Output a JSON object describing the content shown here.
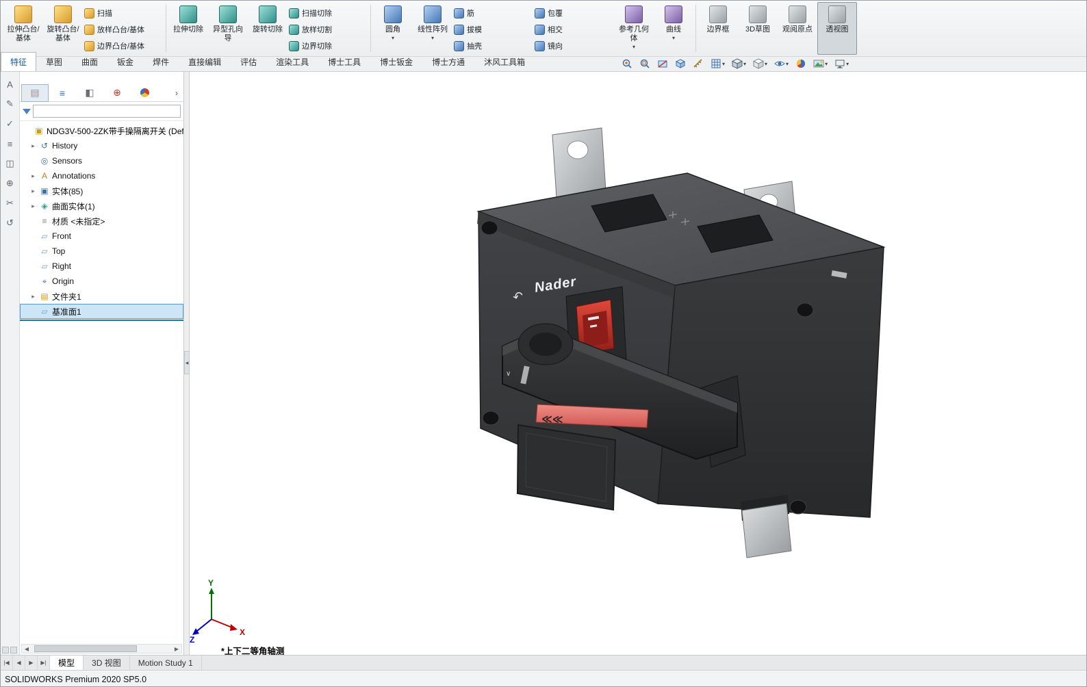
{
  "app": {
    "status_bar": "SOLIDWORKS Premium 2020 SP5.0"
  },
  "ribbon": {
    "items": [
      {
        "type": "big",
        "label": "拉伸凸台/基体",
        "icon": "extrude-boss-icon"
      },
      {
        "type": "big",
        "label": "旋转凸台/基体",
        "icon": "revolve-boss-icon"
      },
      {
        "type": "col",
        "items": [
          {
            "label": "扫描",
            "icon": "sweep-icon"
          },
          {
            "label": "放样凸台/基体",
            "icon": "loft-icon"
          },
          {
            "label": "边界凸台/基体",
            "icon": "boundary-boss-icon"
          }
        ]
      },
      {
        "type": "sep"
      },
      {
        "type": "big",
        "label": "拉伸切除",
        "icon": "extrude-cut-icon"
      },
      {
        "type": "big",
        "label": "异型孔向导",
        "icon": "hole-wizard-icon"
      },
      {
        "type": "big",
        "label": "旋转切除",
        "icon": "revolve-cut-icon"
      },
      {
        "type": "col",
        "items": [
          {
            "label": "扫描切除",
            "icon": "sweep-cut-icon"
          },
          {
            "label": "放样切割",
            "icon": "loft-cut-icon"
          },
          {
            "label": "边界切除",
            "icon": "boundary-cut-icon"
          }
        ]
      },
      {
        "type": "sep"
      },
      {
        "type": "big",
        "label": "圆角",
        "icon": "fillet-icon",
        "caret": true
      },
      {
        "type": "big",
        "label": "线性阵列",
        "icon": "linear-pattern-icon",
        "caret": true
      },
      {
        "type": "col",
        "items": [
          {
            "label": "筋",
            "icon": "rib-icon"
          },
          {
            "label": "拔模",
            "icon": "draft-icon"
          },
          {
            "label": "抽壳",
            "icon": "shell-icon"
          }
        ]
      },
      {
        "type": "col",
        "items": [
          {
            "label": "包覆",
            "icon": "wrap-icon"
          },
          {
            "label": "相交",
            "icon": "intersect-icon"
          },
          {
            "label": "镜向",
            "icon": "mirror-icon"
          }
        ]
      },
      {
        "type": "big",
        "label": "参考几何体",
        "icon": "reference-geometry-icon",
        "caret": true
      },
      {
        "type": "big",
        "label": "曲线",
        "icon": "curves-icon",
        "caret": true
      },
      {
        "type": "sep"
      },
      {
        "type": "big",
        "label": "边界框",
        "icon": "bounding-box-icon"
      },
      {
        "type": "big",
        "label": "3D草图",
        "icon": "3d-sketch-icon"
      },
      {
        "type": "big",
        "label": "观阅原点",
        "icon": "view-origin-icon"
      },
      {
        "type": "big",
        "label": "透视图",
        "icon": "perspective-icon",
        "active": true
      }
    ],
    "tabs": [
      {
        "label": "特征",
        "name": "features",
        "active": true
      },
      {
        "label": "草图",
        "name": "sketch"
      },
      {
        "label": "曲面",
        "name": "surface"
      },
      {
        "label": "钣金",
        "name": "sheet-metal"
      },
      {
        "label": "焊件",
        "name": "weldments"
      },
      {
        "label": "直接编辑",
        "name": "direct-editing"
      },
      {
        "label": "评估",
        "name": "evaluate"
      },
      {
        "label": "渲染工具",
        "name": "render-tools"
      },
      {
        "label": "博士工具",
        "name": "boshi-tools"
      },
      {
        "label": "博士钣金",
        "name": "boshi-sheet-metal"
      },
      {
        "label": "博士方通",
        "name": "boshi-fangtong"
      },
      {
        "label": "沐风工具箱",
        "name": "mufeng-toolbox"
      }
    ],
    "view_toolbar": [
      {
        "icon": "zoom-fit-icon"
      },
      {
        "icon": "zoom-area-icon"
      },
      {
        "icon": "section-view-icon"
      },
      {
        "icon": "view-cube-icon"
      },
      {
        "icon": "measure-icon"
      },
      {
        "icon": "grid-icon",
        "caret": true
      },
      {
        "icon": "view-orientation-icon",
        "caret": true
      },
      {
        "icon": "display-style-icon",
        "caret": true
      },
      {
        "icon": "hide-show-icon",
        "caret": true
      },
      {
        "icon": "edit-appearance-icon"
      },
      {
        "icon": "apply-scene-icon",
        "caret": true
      },
      {
        "icon": "monitor-icon",
        "caret": true
      }
    ]
  },
  "left_toolbar": {
    "icons": [
      "annotation-a-icon",
      "pencil-icon",
      "spellcheck-icon",
      "stack-icon",
      "window-icon",
      "target-icon",
      "scissors-icon",
      "rotate-icon"
    ]
  },
  "feature_panel": {
    "header_tabs": [
      {
        "icon": "feature-manager-icon",
        "active": true
      },
      {
        "icon": "property-manager-icon"
      },
      {
        "icon": "configuration-manager-icon"
      },
      {
        "icon": "dimxpert-manager-icon"
      },
      {
        "icon": "display-manager-icon"
      }
    ],
    "chevron": "›",
    "filter": {
      "placeholder": "",
      "value": ""
    },
    "root": {
      "label": "NDG3V-500-2ZK带手操隔离开关 (Def",
      "icon": "part-icon"
    },
    "items": [
      {
        "label": "History",
        "icon": "history-icon",
        "expandable": true
      },
      {
        "label": "Sensors",
        "icon": "sensors-icon",
        "expandable": false
      },
      {
        "label": "Annotations",
        "icon": "annotations-icon",
        "expandable": true
      },
      {
        "label": "实体(85)",
        "icon": "solid-bodies-icon",
        "expandable": true
      },
      {
        "label": "曲面实体(1)",
        "icon": "surface-bodies-icon",
        "expandable": true
      },
      {
        "label": "材质 <未指定>",
        "icon": "material-icon",
        "expandable": false
      },
      {
        "label": "Front",
        "icon": "plane-icon",
        "expandable": false
      },
      {
        "label": "Top",
        "icon": "plane-icon",
        "expandable": false
      },
      {
        "label": "Right",
        "icon": "plane-icon",
        "expandable": false
      },
      {
        "label": "Origin",
        "icon": "origin-icon",
        "expandable": false
      },
      {
        "label": "文件夹1",
        "icon": "folder-icon",
        "expandable": true
      },
      {
        "label": "基准面1",
        "icon": "plane-icon",
        "expandable": false,
        "selected": true
      }
    ]
  },
  "viewport": {
    "brand": "Nader",
    "view_label": "*上下二等角轴测",
    "handle_chevrons": "≪≪",
    "triad": {
      "x": "X",
      "y": "Y",
      "z": "Z"
    },
    "colors": {
      "handle_red": "#d95f58",
      "rocker_red": "#c02a20",
      "body_dark": "#36373a",
      "metal": "#c6c8ca"
    }
  },
  "bottom_bar": {
    "nav": [
      "|◀",
      "◀",
      "▶",
      "▶|"
    ],
    "tabs": [
      {
        "label": "模型",
        "name": "model",
        "active": true
      },
      {
        "label": "3D 视图",
        "name": "3d-views"
      },
      {
        "label": "Motion Study 1",
        "name": "motion-study-1"
      }
    ]
  }
}
